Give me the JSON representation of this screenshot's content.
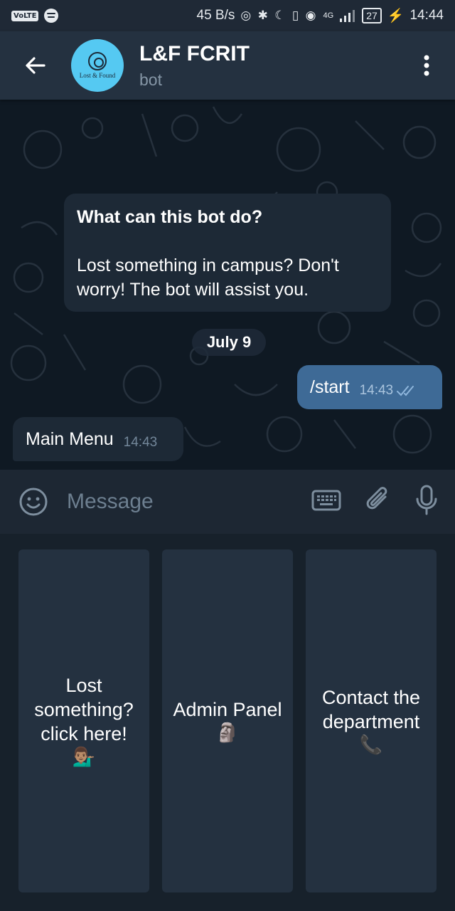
{
  "status_bar": {
    "volte": "VoLTE",
    "speed": "45 B/s",
    "network": "4G",
    "battery": "27",
    "time": "14:44"
  },
  "header": {
    "title": "L&F FCRIT",
    "subtitle": "bot",
    "avatar_text": "Lost & Found"
  },
  "chat": {
    "info_title": "What can this bot do?",
    "info_body": "Lost something in campus? Don't worry! The bot will assist you.",
    "date": "July 9",
    "outgoing": {
      "text": "/start",
      "time": "14:43"
    },
    "incoming": {
      "text": "Main Menu",
      "time": "14:43"
    }
  },
  "input": {
    "placeholder": "Message"
  },
  "keyboard": {
    "buttons": [
      {
        "label": "Lost something? click here!",
        "emoji": "💁🏽‍♂️",
        "icon": "person-tipping-hand-icon"
      },
      {
        "label": "Admin Panel",
        "emoji": "🗿",
        "icon": "moai-icon"
      },
      {
        "label": "Contact the department",
        "emoji": "📞",
        "icon": "telephone-receiver-icon"
      }
    ]
  },
  "colors": {
    "header_bg": "#243140",
    "chat_bg": "#0f1923",
    "outgoing_bubble": "#3e6a96",
    "incoming_bubble": "#1d2936",
    "keyboard_button": "#243140"
  }
}
